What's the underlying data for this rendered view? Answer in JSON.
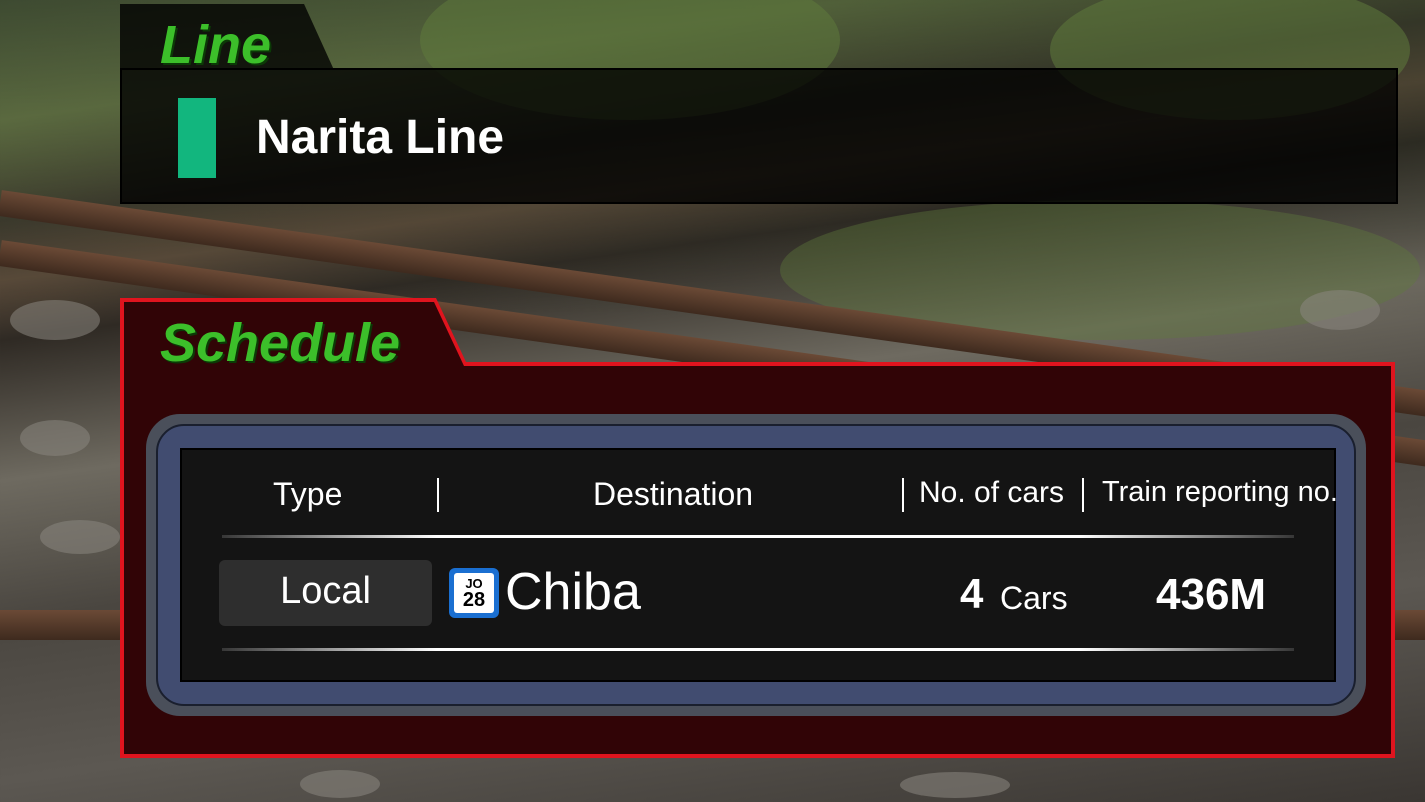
{
  "line_panel": {
    "tab_label": "Line",
    "line_name": "Narita Line",
    "line_color": "#12b67e"
  },
  "schedule_panel": {
    "tab_label": "Schedule",
    "outline_color": "#e0141e",
    "headers": {
      "type": "Type",
      "destination": "Destination",
      "cars": "No. of cars",
      "report_no": "Train reporting no."
    },
    "row": {
      "type": "Local",
      "station_code_line": "JO",
      "station_code_num": "28",
      "station_badge_color": "#1a6fd1",
      "destination": "Chiba",
      "cars_count": "4",
      "cars_unit": "Cars",
      "report_no": "436M"
    }
  },
  "accent_colors": {
    "tab_label_green": "#3cbf2a"
  }
}
